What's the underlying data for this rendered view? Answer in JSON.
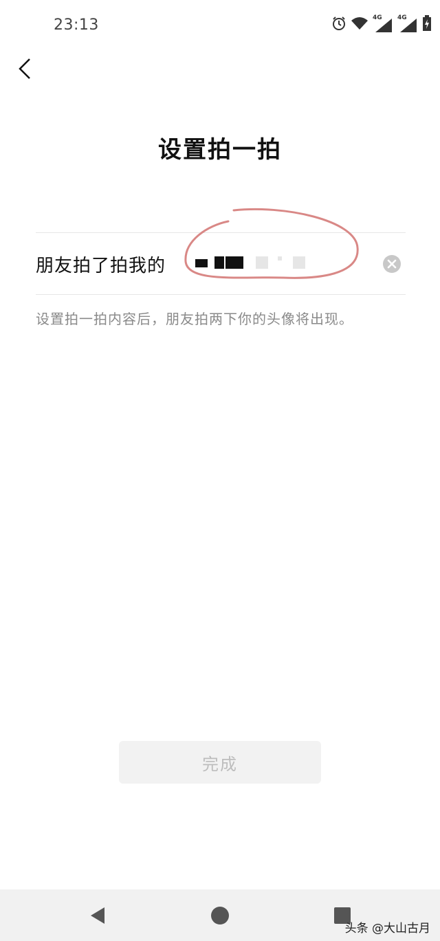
{
  "status_bar": {
    "time": "23:13",
    "icons": [
      "alarm-icon",
      "wifi-icon",
      "signal-4g-icon",
      "signal-4g-icon",
      "battery-icon"
    ],
    "network_label_1": "4G",
    "network_label_2": "4G"
  },
  "header": {
    "title": "设置拍一拍"
  },
  "form": {
    "label": "朋友拍了拍我的",
    "value_redacted": true,
    "clear_icon": "clear-circle-icon",
    "hint": "设置拍一拍内容后，朋友拍两下你的头像将出现。"
  },
  "footer": {
    "done_label": "完成"
  },
  "nav_bar": {
    "items": [
      "back-triangle-icon",
      "home-circle-icon",
      "recents-square-icon"
    ]
  },
  "watermark": "头条 @大山古月",
  "colors": {
    "annotation": "#d98886",
    "button_bg": "#f2f2f2",
    "button_text": "#bdbdbd",
    "hint_text": "#8a8a8a"
  }
}
